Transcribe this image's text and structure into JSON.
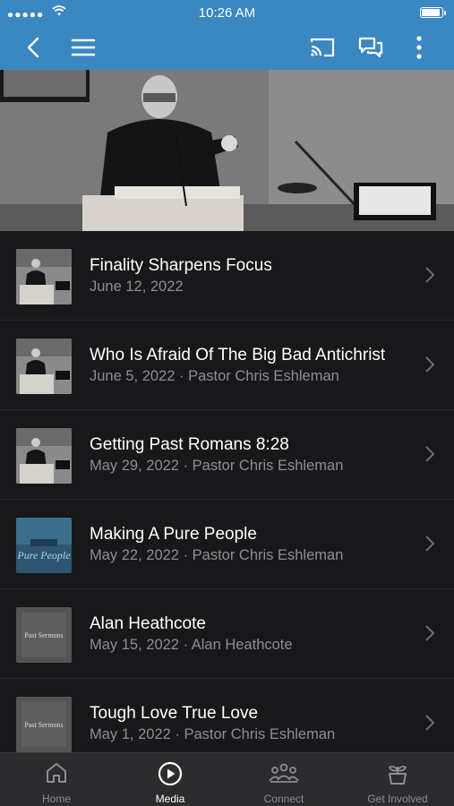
{
  "status_bar": {
    "time": "10:26 AM",
    "signal": "●●●●●"
  },
  "nav": {
    "back": "back-icon",
    "menu": "menu-icon",
    "cast": "cast-icon",
    "chat": "chat-icon",
    "more": "more-icon"
  },
  "colors": {
    "accent": "#3a87c2",
    "background": "#18181a",
    "tab_bar": "#2c2c2e"
  },
  "sermons": [
    {
      "title": "Finality Sharpens Focus",
      "subtitle": "June 12, 2022"
    },
    {
      "title": "Who Is Afraid Of The Big Bad Antichrist",
      "subtitle": "June 5, 2022 · Pastor Chris Eshleman"
    },
    {
      "title": "Getting Past Romans 8:28",
      "subtitle": "May 29, 2022 · Pastor Chris Eshleman"
    },
    {
      "title": "Making A Pure People",
      "subtitle": "May 22, 2022 · Pastor Chris Eshleman",
      "thumb_text": "Pure People"
    },
    {
      "title": "Alan Heathcote",
      "subtitle": "May 15, 2022 · Alan Heathcote",
      "thumb_text": "Past Sermons"
    },
    {
      "title": "Tough Love True Love",
      "subtitle": "May 1, 2022 · Pastor Chris Eshleman",
      "thumb_text": "Past Sermons"
    }
  ],
  "tabs": [
    {
      "label": "Home",
      "icon": "home-icon"
    },
    {
      "label": "Media",
      "icon": "play-icon",
      "active": true
    },
    {
      "label": "Connect",
      "icon": "people-icon"
    },
    {
      "label": "Get Involved",
      "icon": "plant-icon"
    }
  ]
}
